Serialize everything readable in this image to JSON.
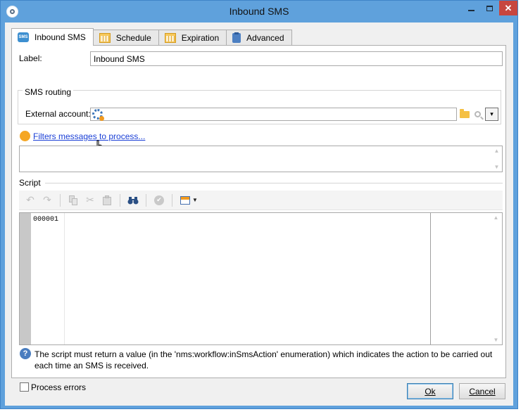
{
  "window": {
    "title": "Inbound SMS",
    "close_glyph": "✕"
  },
  "tabs": [
    {
      "label": "Inbound SMS",
      "icon": "sms-icon",
      "active": true
    },
    {
      "label": "Schedule",
      "icon": "calendar-icon"
    },
    {
      "label": "Expiration",
      "icon": "calendar-icon"
    },
    {
      "label": "Advanced",
      "icon": "clipboard-icon"
    }
  ],
  "form": {
    "label_caption": "Label:",
    "label_value": "Inbound SMS",
    "routing_title": "SMS routing",
    "external_account_caption": "External account:",
    "external_account_value": "",
    "filter_link": "Filters messages to process...",
    "filter_value": ""
  },
  "script": {
    "title": "Script",
    "line_number": "000001",
    "content": "",
    "help_text": "The script must return a value (in the 'nms:workflow:inSmsAction' enumeration) which indicates the action to be carried out each time an SMS is received."
  },
  "options": {
    "process_errors_label": "Process errors",
    "process_errors_checked": false
  },
  "buttons": {
    "ok": "Ok",
    "cancel": "Cancel"
  },
  "icons": {
    "sms_badge": "SMS",
    "scroll_up": "▲",
    "scroll_down": "▼",
    "dropdown": "▾",
    "undo": "↶",
    "redo": "↷",
    "cut": "✂",
    "binoculars": "⚭",
    "check": "✔",
    "help": "?"
  },
  "colors": {
    "titlebar": "#5fa1dc",
    "close_button": "#c7463f",
    "link": "#1a3fd6",
    "filter_dot": "#f5a623"
  }
}
